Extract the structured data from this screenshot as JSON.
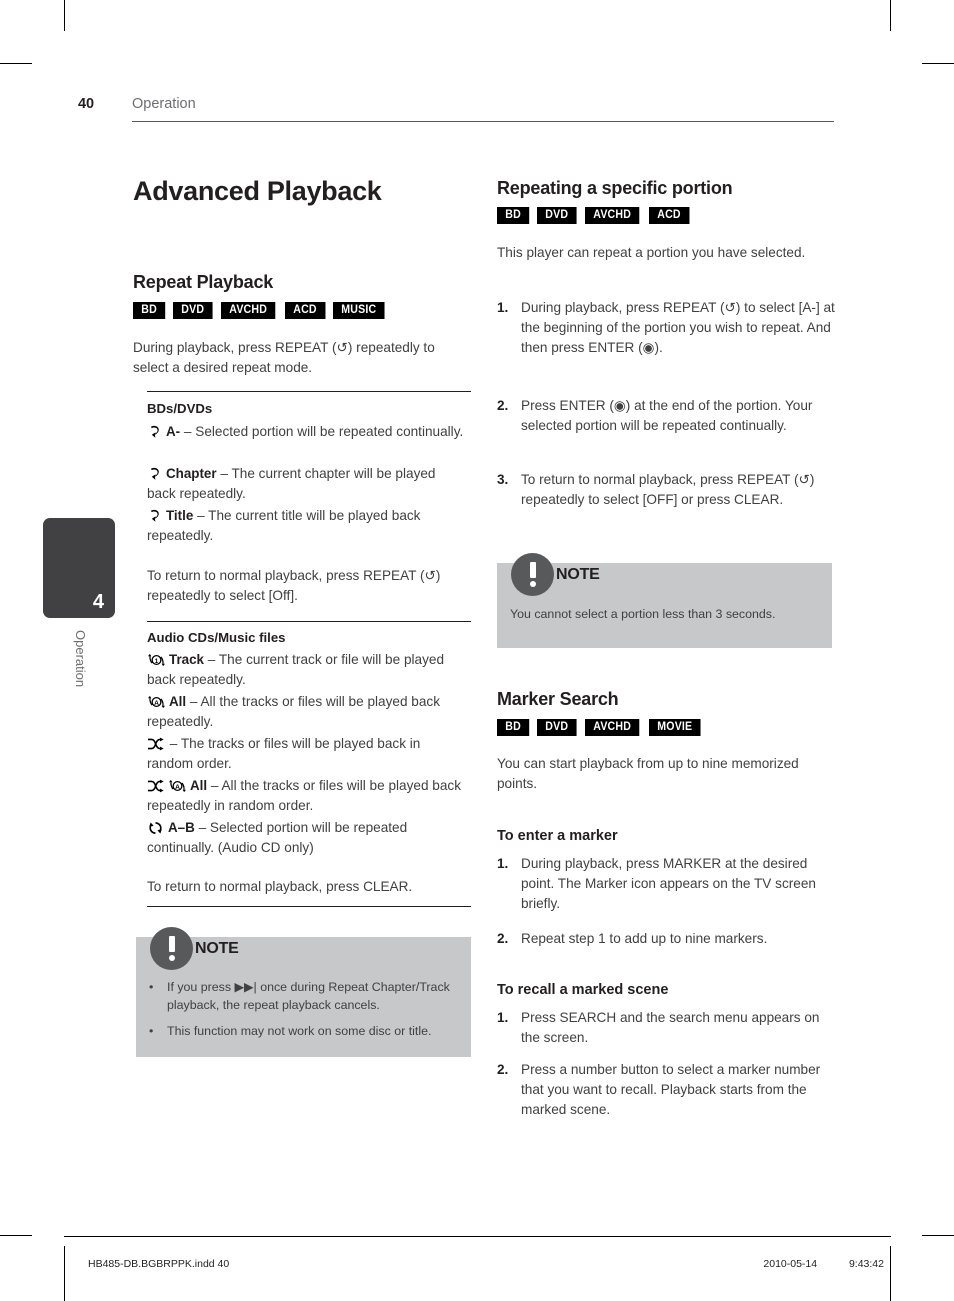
{
  "header": {
    "page_number": "40",
    "section": "Operation"
  },
  "side_tab": {
    "number": "4",
    "label": "Operation"
  },
  "left_column": {
    "chapter_title": "Advanced Playback",
    "repeat_playback": {
      "heading": "Repeat Playback",
      "badges": [
        "BD",
        "DVD",
        "AVCHD",
        "ACD",
        "MUSIC"
      ],
      "intro": "During playback, press REPEAT (↺) repeatedly to select a desired repeat mode.",
      "bd_dvd": {
        "heading": "BDs/DVDs",
        "items": [
          {
            "icon": "repeat-arrow-icon",
            "label": "A-",
            "text": " – Selected portion will be repeated continually."
          },
          {
            "icon": "repeat-arrow-icon",
            "label": "Chapter",
            "text": " – The current chapter will be played back repeatedly."
          },
          {
            "icon": "repeat-arrow-icon",
            "label": "Title",
            "text": " – The current title will be played back repeatedly."
          }
        ],
        "footer": "To return to normal playback, press REPEAT (↺) repeatedly to select [Off]."
      },
      "audio_cd": {
        "heading": "Audio CDs/Music files",
        "items": [
          {
            "icon": "repeat-one-icon",
            "label": "Track",
            "text": " – The current track or file will be played back repeatedly."
          },
          {
            "icon": "repeat-all-icon",
            "label": "All",
            "text": " – All the tracks or files will be played back repeatedly."
          },
          {
            "icon": "shuffle-icon",
            "label": "",
            "text": " – The tracks or files will be played back in random order."
          },
          {
            "icon": "shuffle-repeat-all-icon",
            "label": "All",
            "text": " – All the tracks or files will be played back repeatedly in random order."
          },
          {
            "icon": "repeat-ab-icon",
            "label": "A–B",
            "text": " – Selected portion will be repeated continually. (Audio CD only)"
          }
        ],
        "footer": "To return to normal playback, press CLEAR."
      }
    },
    "note": {
      "title": "NOTE",
      "bullets": [
        "If you press ▶▶| once during Repeat Chapter/Track playback, the repeat playback cancels.",
        "This function may not work on some disc or title."
      ]
    }
  },
  "right_column": {
    "repeating_portion": {
      "heading": "Repeating a specific portion",
      "badges": [
        "BD",
        "DVD",
        "AVCHD",
        "ACD"
      ],
      "intro": "This player can repeat a portion you have selected.",
      "steps": [
        {
          "num": "1.",
          "text": "During playback, press REPEAT (↺) to select [A-] at the beginning of the portion you wish to repeat. And then press ENTER (◉)."
        },
        {
          "num": "2.",
          "text": "Press ENTER (◉) at the end of the portion. Your selected portion will be repeated continually."
        },
        {
          "num": "3.",
          "text": "To return to normal playback, press REPEAT (↺) repeatedly to select [OFF] or press CLEAR."
        }
      ],
      "note": {
        "title": "NOTE",
        "text": "You cannot select a portion less than 3 seconds."
      }
    },
    "marker_search": {
      "heading": "Marker Search",
      "badges": [
        "BD",
        "DVD",
        "AVCHD",
        "MOVIE"
      ],
      "intro": "You can start playback from up to nine memorized points.",
      "enter_marker": {
        "heading": "To enter a marker",
        "steps": [
          {
            "num": "1.",
            "text": "During playback, press MARKER at the desired point. The Marker icon appears on the TV screen briefly."
          },
          {
            "num": "2.",
            "text": "Repeat step 1 to add up to nine markers."
          }
        ]
      },
      "recall_scene": {
        "heading": "To recall a marked scene",
        "steps": [
          {
            "num": "1.",
            "text": "Press SEARCH and the search menu appears on the screen."
          },
          {
            "num": "2.",
            "text": "Press a number button to select a marker number that you want to recall. Playback starts from the marked scene."
          }
        ]
      }
    }
  },
  "footer": {
    "file": "HB485-DB.BGBRPPK.indd   40",
    "date": "2010-05-14",
    "time": "9:43:42"
  },
  "colors": {
    "badge_bg": "#000000",
    "note_bg": "#c7c8ca",
    "note_circle": "#58595b",
    "tab_bg": "#414042",
    "body_text": "#414042",
    "heading_text": "#231f20"
  }
}
